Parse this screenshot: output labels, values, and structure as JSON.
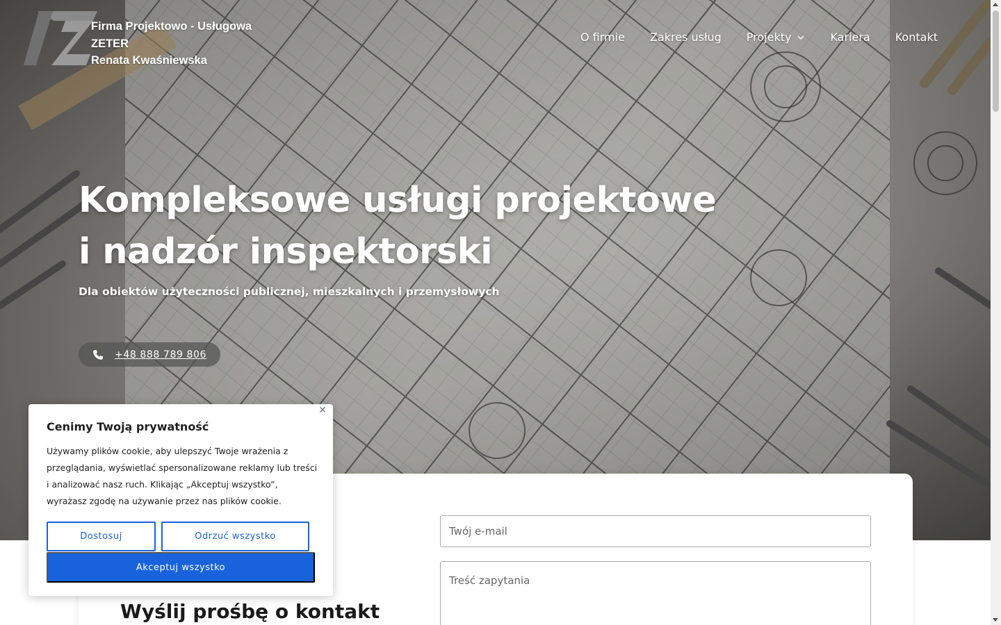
{
  "header": {
    "company_lines": [
      "Firma Projektowo - Usługowa",
      "ZETER",
      "Renata Kwaśniewska"
    ],
    "logo_icon": "zeter-logo"
  },
  "nav": {
    "items": [
      {
        "label": "O firmie"
      },
      {
        "label": "Zakres usług"
      },
      {
        "label": "Projekty",
        "has_dropdown": true
      },
      {
        "label": "Kariera"
      },
      {
        "label": "Kontakt"
      }
    ]
  },
  "hero": {
    "headline_line1": "Kompleksowe usługi projektowe",
    "headline_line2": "i nadzór inspektorski",
    "subheadline": "Dla obiektów użyteczności publicznej, mieszkalnych i przemysłowych",
    "phone": "+48 888 789 806",
    "phone_icon": "phone-icon"
  },
  "contact": {
    "title": "Wyślij prośbę o kontakt",
    "email_placeholder": "Twój e-mail",
    "query_placeholder": "Treść zapytania"
  },
  "cookie": {
    "title": "Cenimy Twoją prywatność",
    "text": "Używamy plików cookie, aby ulepszyć Twoje wrażenia z przeglądania, wyświetlać spersonalizowane reklamy lub treści i analizować nasz ruch. Klikając „Akceptuj wszystko”, wyrażasz zgodę na używanie przez nas plików cookie.",
    "customize_label": "Dostosuj",
    "reject_label": "Odrzuć wszystko",
    "accept_label": "Akceptuj wszystko",
    "close_icon": "close-icon"
  },
  "colors": {
    "accent": "#1863dc",
    "text_dark": "#212121",
    "phone_button_bg": "#555555"
  }
}
